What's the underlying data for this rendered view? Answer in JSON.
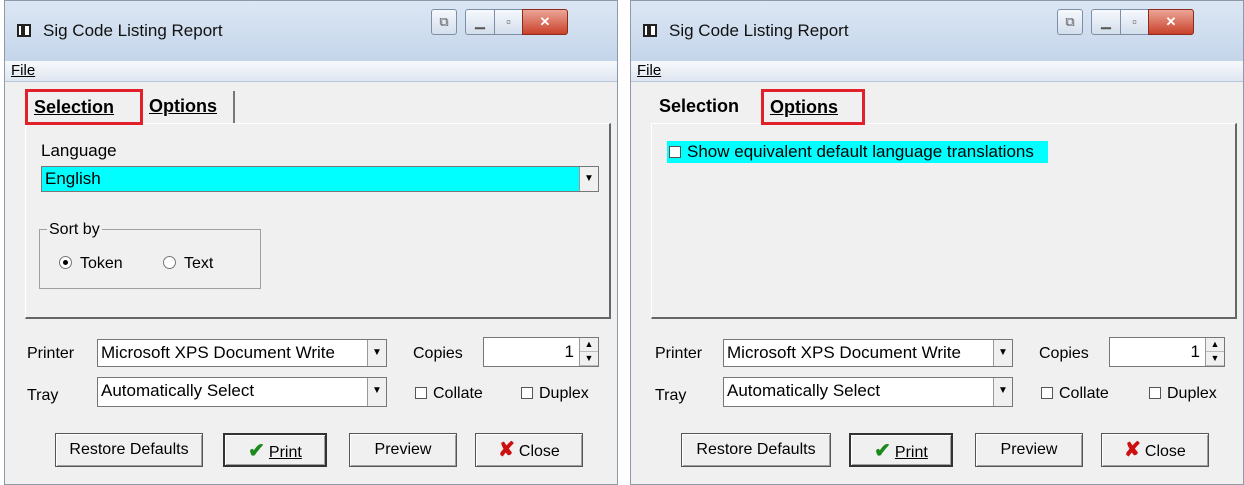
{
  "windows": [
    {
      "title": "Sig Code Listing Report",
      "menu": {
        "file": "File"
      },
      "tabs": {
        "selection": "Selection",
        "options": "Options"
      },
      "active_tab": "Selection",
      "selection": {
        "language_label": "Language",
        "language_value": "English",
        "sort_by_label": "Sort by",
        "sort_options": [
          "Token",
          "Text"
        ],
        "sort_selected": "Token"
      },
      "printer_label": "Printer",
      "printer_value": "Microsoft XPS Document Write",
      "tray_label": "Tray",
      "tray_value": "Automatically Select",
      "copies_label": "Copies",
      "copies_value": "1",
      "collate_label": "Collate",
      "duplex_label": "Duplex",
      "buttons": {
        "restore": "Restore Defaults",
        "print": "Print",
        "preview": "Preview",
        "close": "Close"
      }
    },
    {
      "title": "Sig Code Listing Report",
      "menu": {
        "file": "File"
      },
      "tabs": {
        "selection": "Selection",
        "options": "Options"
      },
      "active_tab": "Options",
      "options": {
        "show_translations_label": "Show equivalent default language translations",
        "show_translations_checked": false
      },
      "printer_label": "Printer",
      "printer_value": "Microsoft XPS Document Write",
      "tray_label": "Tray",
      "tray_value": "Automatically Select",
      "copies_label": "Copies",
      "copies_value": "1",
      "collate_label": "Collate",
      "duplex_label": "Duplex",
      "buttons": {
        "restore": "Restore Defaults",
        "print": "Print",
        "preview": "Preview",
        "close": "Close"
      }
    }
  ],
  "colors": {
    "highlight": "#00ffff",
    "tab_callout": "#e0202a",
    "print_check": "#1b8a1b",
    "close_x": "#cc1010"
  }
}
